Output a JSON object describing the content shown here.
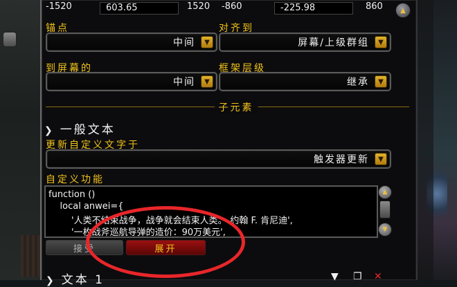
{
  "coords": {
    "x_min": "-1520",
    "x_value": "603.65",
    "x_max": "1520",
    "y_min": "-860",
    "y_value": "-225.98",
    "y_max": "860"
  },
  "fields": {
    "anchor_label": "锚点",
    "anchor_value": "中间",
    "align_to_label": "对齐到",
    "align_to_value": "屏幕/上级群组",
    "to_screen_label": "到屏幕的",
    "to_screen_value": "中间",
    "frame_strata_label": "框架层级",
    "frame_strata_value": "继承"
  },
  "subelements": {
    "title": "子元素",
    "general_text_header": "一般文本",
    "update_custom_text_label": "更新自定义文字于",
    "update_custom_text_value": "触发器更新",
    "custom_function_label": "自定义功能",
    "code_lines": [
      "function ()",
      "    local anwei={",
      "        '人类不结束战争，战争就会结束人类。-约翰 F. 肯尼迪',",
      "        '一枚战斧巡航导弹的造价：90万美元',"
    ],
    "accept_label": "接受",
    "expand_label": "展开",
    "text1_header": "文本 1"
  },
  "colors": {
    "accent_gold": "#f2c319",
    "highlight_circle": "#e8262a",
    "expand_button": "#9a1010"
  }
}
